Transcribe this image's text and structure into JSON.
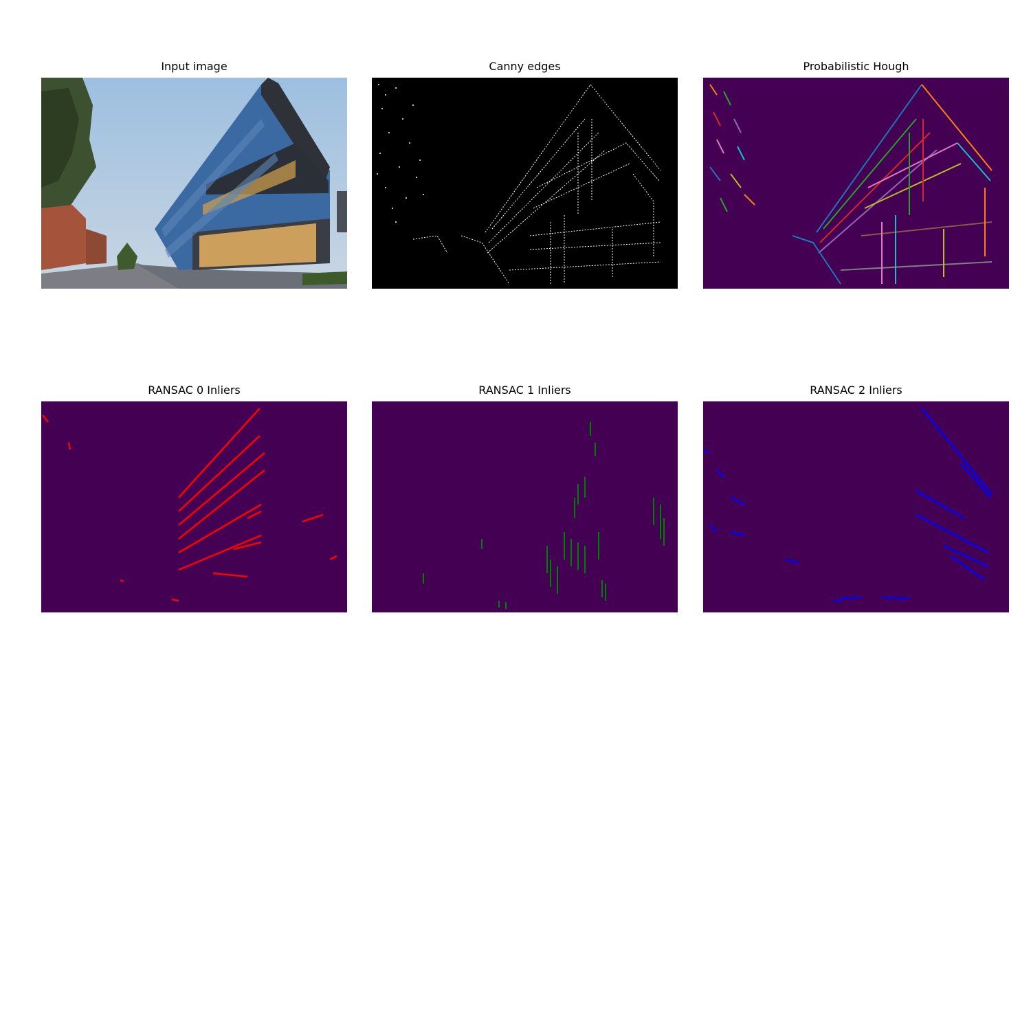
{
  "figure": {
    "panels": [
      {
        "id": "input",
        "title": "Input image",
        "kind": "photo"
      },
      {
        "id": "canny",
        "title": "Canny edges",
        "kind": "edges"
      },
      {
        "id": "hough",
        "title": "Probabilistic Hough",
        "kind": "hough"
      },
      {
        "id": "ransac0",
        "title": "RANSAC 0 Inliers",
        "kind": "inliers",
        "line_color": "#ff0000"
      },
      {
        "id": "ransac1",
        "title": "RANSAC 1 Inliers",
        "kind": "inliers",
        "line_color": "#008000"
      },
      {
        "id": "ransac2",
        "title": "RANSAC 2 Inliers",
        "kind": "inliers",
        "line_color": "#0000ff"
      }
    ]
  },
  "colors": {
    "background": "#ffffff",
    "panel_dark_purple": "#440154",
    "canny_background": "#000000",
    "canny_edges": "#ffffff",
    "sky": "#a9c4dd",
    "building_glass": "#3c6aa0",
    "building_frame": "#2e3238",
    "window_light": "#e8b060"
  }
}
